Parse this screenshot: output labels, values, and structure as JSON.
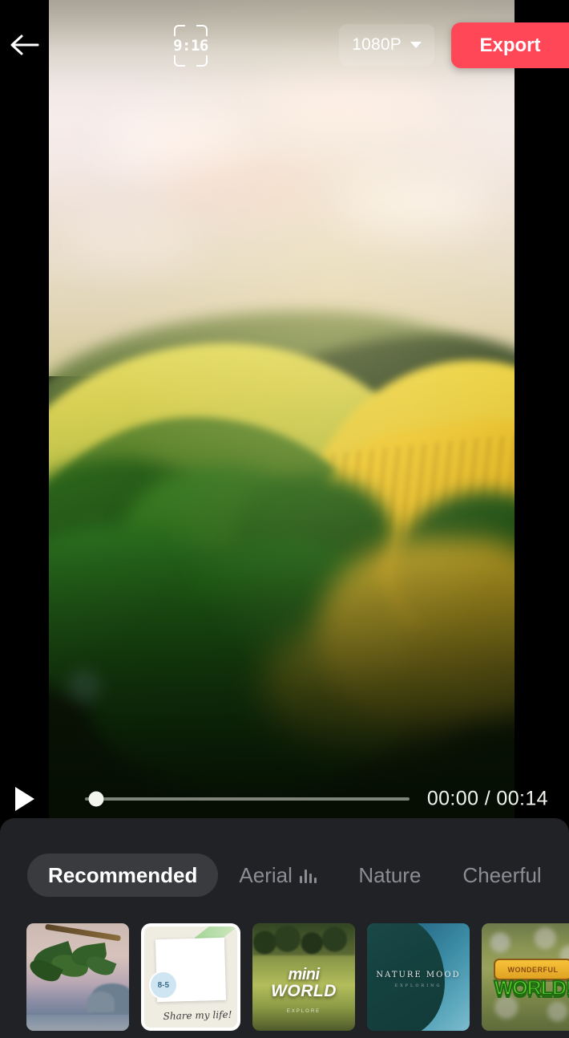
{
  "header": {
    "back_icon": "arrow-left-icon",
    "aspect_ratio": {
      "label": "9:16",
      "icon": "aspect-ratio-frame-icon"
    },
    "resolution": {
      "label": "1080P",
      "caret_icon": "chevron-down-icon"
    },
    "export": {
      "label": "Export",
      "color": "#FF4757"
    }
  },
  "player": {
    "play_icon": "play-triangle-icon",
    "current_time": "00:00",
    "total_time": "00:14",
    "timecode": "00:00 / 00:14",
    "progress_percent": 0
  },
  "panel": {
    "tabs": [
      {
        "label": "Recommended",
        "active": true,
        "icon": null
      },
      {
        "label": "Aerial",
        "active": false,
        "icon": "equalizer-icon"
      },
      {
        "label": "Nature",
        "active": false,
        "icon": null
      },
      {
        "label": "Cheerful",
        "active": false,
        "icon": null
      }
    ],
    "templates": [
      {
        "name": "palm-beach-template",
        "selected": false,
        "caption": ""
      },
      {
        "name": "polaroid-share-my-life-template",
        "selected": true,
        "caption": "Share my life!",
        "sticker": "8-5"
      },
      {
        "name": "mini-world-template",
        "selected": false,
        "title_line1": "mini",
        "title_line2": "WORLD",
        "subtitle": "EXPLORE"
      },
      {
        "name": "nature-mood-template",
        "selected": false,
        "title": "NATURE MOOD",
        "subtitle": "EXPLORING"
      },
      {
        "name": "wonderful-world-template",
        "selected": false,
        "banner_text": "WONDERFUL",
        "title": "WORLD!"
      }
    ]
  },
  "colors": {
    "accent": "#FF4757",
    "panel_bg": "#212225",
    "tab_active_bg": "#3A3B3F",
    "tab_inactive_text": "#8B8D93"
  }
}
